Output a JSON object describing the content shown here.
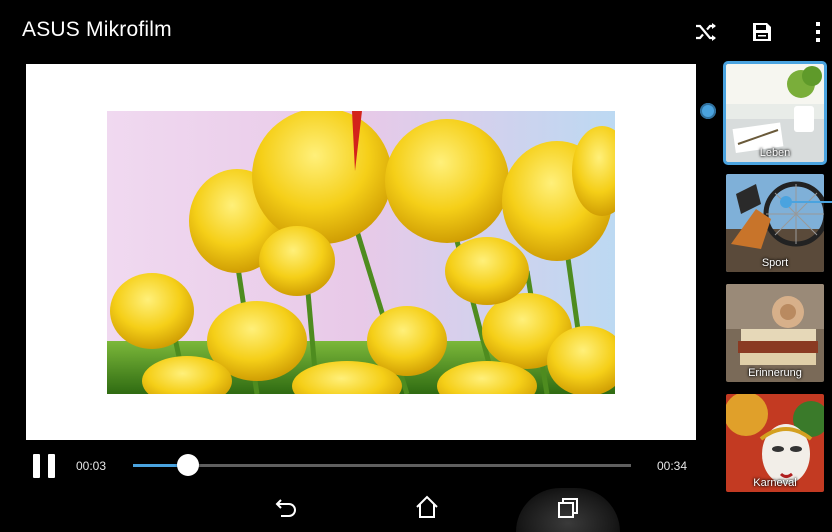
{
  "app": {
    "title": "ASUS Mikrofilm",
    "accent_color": "#4aa3df",
    "icons": [
      "shuffle-icon",
      "save-icon",
      "overflow-menu-icon"
    ]
  },
  "player": {
    "current_time": "00:03",
    "total_time": "00:34",
    "progress": 0.11,
    "state": "playing",
    "pause_icon": "pause-icon"
  },
  "themes": [
    {
      "label": "Leben",
      "selected": true
    },
    {
      "label": "Sport",
      "selected": false
    },
    {
      "label": "Erinnerung",
      "selected": false
    },
    {
      "label": "Karneval",
      "selected": false
    }
  ],
  "navbar": {
    "icons": [
      "back-icon",
      "home-icon",
      "recent-apps-icon"
    ]
  }
}
